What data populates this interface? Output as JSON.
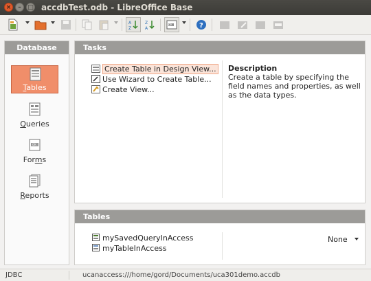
{
  "window": {
    "title": "accdbTest.odb - LibreOffice Base",
    "controls": [
      "close-icon",
      "minimize-icon",
      "maximize-icon"
    ]
  },
  "toolbar": {
    "buttons": [
      "new-document-icon",
      "open-icon",
      "save-icon",
      "copy-icon",
      "paste-icon",
      "sort-ascending-icon",
      "sort-descending-icon",
      "form-icon",
      "help-icon",
      "table-icon",
      "edit-icon",
      "delete-icon",
      "rename-icon"
    ]
  },
  "database": {
    "header": "Database",
    "items": [
      {
        "label": "Tables",
        "accel": "T",
        "rest": "ables",
        "icon": "tables-icon",
        "selected": true
      },
      {
        "label": "Queries",
        "accel": "Q",
        "rest": "ueries",
        "icon": "queries-icon",
        "selected": false
      },
      {
        "label": "Forms",
        "pre": "For",
        "accel": "m",
        "rest": "s",
        "icon": "forms-icon",
        "selected": false
      },
      {
        "label": "Reports",
        "accel": "R",
        "rest": "eports",
        "icon": "reports-icon",
        "selected": false
      }
    ]
  },
  "tasks": {
    "header": "Tasks",
    "items": [
      {
        "label": "Create Table in Design View...",
        "icon": "design-view-icon",
        "selected": true
      },
      {
        "label": "Use Wizard to Create Table...",
        "icon": "wizard-icon",
        "selected": false
      },
      {
        "label": "Create View...",
        "icon": "view-icon",
        "selected": false
      }
    ],
    "description_title": "Description",
    "description_text": "Create a table by specifying the field names and properties, as well as the data types."
  },
  "tables": {
    "header": "Tables",
    "items": [
      {
        "label": "mySavedQueryInAccess",
        "icon": "linked-table-icon"
      },
      {
        "label": "myTableInAccess",
        "icon": "table-icon"
      }
    ],
    "preview_label": "None"
  },
  "status": {
    "driver": "JDBC",
    "url": "ucanaccess:///home/gord/Documents/uca301demo.accdb"
  },
  "colors": {
    "selection": "#f08e6a",
    "header": "#9c9b98",
    "close_button": "#e05a2b"
  }
}
